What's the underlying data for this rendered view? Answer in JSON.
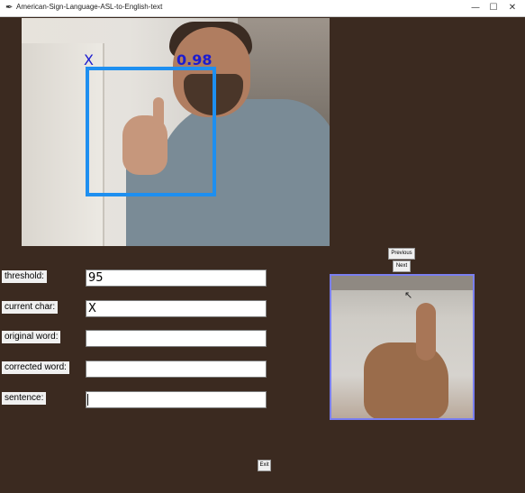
{
  "window": {
    "title": "American-Sign-Language-ASL-to-English-text",
    "minimize_glyph": "—",
    "maximize_glyph": "☐",
    "close_glyph": "✕"
  },
  "camera": {
    "predicted_char": "X",
    "confidence": "0.98",
    "box_color": "#1e8ff0",
    "label_color": "#1c1cd0"
  },
  "form": {
    "threshold_label": "threshold:",
    "threshold_value": "95",
    "current_char_label": "current char:",
    "current_char_value": "X",
    "original_word_label": "original word:",
    "original_word_value": "",
    "corrected_word_label": "corrected word:",
    "corrected_word_value": "",
    "sentence_label": "sentence:",
    "sentence_value": ""
  },
  "buttons": {
    "previous": "Previous",
    "next": "Next",
    "exit": "Exit"
  },
  "colors": {
    "background": "#3b2a20",
    "roi_border": "#7a7ff0"
  }
}
